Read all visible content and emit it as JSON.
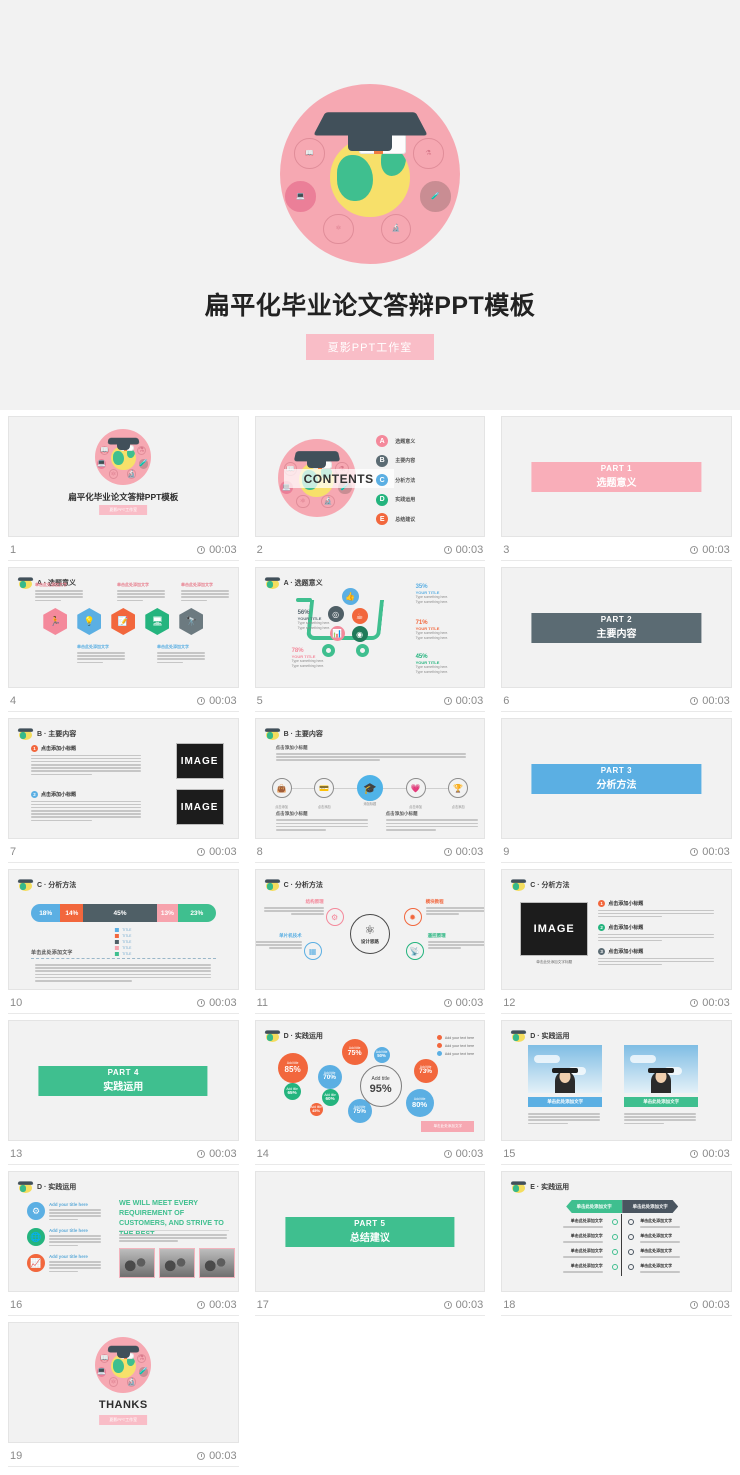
{
  "hero": {
    "title": "扁平化毕业论文答辩PPT模板",
    "badge": "夏影PPT工作室",
    "emblem_icons": [
      "book-icon",
      "microscope-stand-icon",
      "laptop-icon",
      "flask-icon",
      "atom-icon",
      "microscope-icon"
    ]
  },
  "colors": {
    "pink": "#f6a8b2",
    "pink_badge": "#f9bdc7",
    "slate": "#5b6b73",
    "blue": "#5bafe3",
    "green": "#3fbf8f",
    "orange": "#f2673d",
    "gray": "#6c7a80",
    "page_bg": "#ffffff",
    "thumb_bg": "#f2f2f2"
  },
  "slides": [
    {
      "index": "1",
      "duration": "00:03",
      "type": "cover",
      "title": "扁平化毕业论文答辩PPT模板",
      "badge": "夏影PPT工作室"
    },
    {
      "index": "2",
      "duration": "00:03",
      "type": "contents",
      "contents_label": "CONTENTS",
      "items": [
        {
          "letter": "A",
          "label": "选题意义",
          "color": "#f4899b"
        },
        {
          "letter": "B",
          "label": "主要内容",
          "color": "#5b6b73"
        },
        {
          "letter": "C",
          "label": "分析方法",
          "color": "#5bafe3"
        },
        {
          "letter": "D",
          "label": "实践运用",
          "color": "#24b47e"
        },
        {
          "letter": "E",
          "label": "总结建议",
          "color": "#f2673d"
        }
      ]
    },
    {
      "index": "3",
      "duration": "00:03",
      "type": "part",
      "part": "PART 1",
      "part_title": "选题意义",
      "banner_color": "#f9aeb9"
    },
    {
      "index": "4",
      "duration": "00:03",
      "type": "hex",
      "header": "A · 选题意义",
      "hexes": [
        {
          "color": "#f4899b",
          "icon": "person-icon"
        },
        {
          "color": "#5bafe3",
          "icon": "bulb-icon"
        },
        {
          "color": "#f2673d",
          "icon": "edit-icon"
        },
        {
          "color": "#24b47e",
          "icon": "monitor-icon"
        },
        {
          "color": "#6c7a80",
          "icon": "rocket-icon"
        }
      ],
      "notes": [
        {
          "title": "单击此处添加文字",
          "body": "点击添加文字内容点击添加文字内容点击添加文字内容点击添加文字内容"
        },
        {
          "title": "单击此处添加文字",
          "body": "点击添加文字内容点击添加文字内容点击添加文字内容点击添加文字内容"
        },
        {
          "title": "单击此处添加文字",
          "body": "点击添加文字内容点击添加文字内容点击添加文字内容点击添加文字内容"
        },
        {
          "title": "单击此处添加文字",
          "body": "点击添加文字内容点击添加文字内容点击添加文字内容点击添加文字内容"
        },
        {
          "title": "单击此处添加文字",
          "body": "点击添加文字内容点击添加文字内容点击添加文字内容点击添加文字内容"
        }
      ]
    },
    {
      "index": "5",
      "duration": "00:03",
      "type": "cart",
      "header": "A · 选题意义",
      "title_text": "YOUR TITLE",
      "body_text": "Type something here.",
      "notes": [
        {
          "pct": "35%",
          "color": "#5bafe3"
        },
        {
          "pct": "56%",
          "color": "#5b6b73"
        },
        {
          "pct": "71%",
          "color": "#f2673d"
        },
        {
          "pct": "78%",
          "color": "#f4899b"
        },
        {
          "pct": "45%",
          "color": "#24b47e"
        }
      ]
    },
    {
      "index": "6",
      "duration": "00:03",
      "type": "part",
      "part": "PART 2",
      "part_title": "主要内容",
      "banner_color": "#5b6b73"
    },
    {
      "index": "7",
      "duration": "00:03",
      "type": "image-text",
      "header": "B · 主要内容",
      "image_label": "IMAGE",
      "blocks": [
        {
          "num": "1",
          "color": "#f2673d",
          "title": "点击添加小标题",
          "body": "点击添加文字内容 点击添加文字内容 点击添加文字内容点击添加文字内容 点击添加文字内容 点击添加文字内容点击添加文字内容点击添加文字内容"
        },
        {
          "num": "2",
          "color": "#5bafe3",
          "title": "点击添加小标题",
          "body": "点击添加文字内容 点击添加文字内容 点击添加文字内容点击添加文字内容 点击添加文字内容 点击添加文字内容点击添加文字内容点击添加文字内容"
        }
      ]
    },
    {
      "index": "8",
      "duration": "00:03",
      "type": "timeline",
      "header": "B · 主要内容",
      "lead_title": "点击添加小标题",
      "lead_body": "点击添加文字内容 点击添加文字内容 点击添加文字内容 点击添加文字内容点击添加文字内容 点击添加文字内容",
      "nodes": [
        {
          "icon": "bag-icon",
          "caption": "点击添加"
        },
        {
          "icon": "card-icon",
          "caption": "点击添加"
        },
        {
          "icon": "graduation-cap-icon",
          "caption": "添加标题",
          "active": true
        },
        {
          "icon": "heart-icon",
          "caption": "点击添加"
        },
        {
          "icon": "cup-icon",
          "caption": "点击添加"
        }
      ],
      "foot_blocks": [
        {
          "title": "点击添加小标题",
          "body": "点击添加文字内容 点击添加文字内容 点击添加文字内容 点击添加文字内容"
        },
        {
          "title": "点击添加小标题",
          "body": "点击添加文字内容 点击添加文字内容 点击添加文字内容 点击添加文字内容"
        }
      ]
    },
    {
      "index": "9",
      "duration": "00:03",
      "type": "part",
      "part": "PART 3",
      "part_title": "分析方法",
      "banner_color": "#5bafe3"
    },
    {
      "index": "10",
      "duration": "00:03",
      "type": "stacked-bar",
      "header": "C · 分析方法",
      "caption": "单击此处添加文字",
      "body": "点击添加文字内容 点击添加文字内容 点击添加文字内容 点击添加文字内容点击添加文字内容 点击添加文字内容 点击添加文字内容 点击添加文字内容点击添加文字内容点击添加文字内容点击添加文字内容点击添加文字内容点击添加文字内容"
    },
    {
      "index": "11",
      "duration": "00:03",
      "type": "mindmap",
      "header": "C · 分析方法",
      "center": "设计思路",
      "branches": [
        {
          "label": "结构原理",
          "color": "#f4899b",
          "icon": "gear-icon"
        },
        {
          "label": "单片机技术",
          "color": "#5bafe3",
          "icon": "chip-icon"
        },
        {
          "label": "模块教程",
          "color": "#f2673d",
          "icon": "module-icon"
        },
        {
          "label": "遥控原理",
          "color": "#24b47e",
          "icon": "antenna-icon"
        }
      ],
      "body": "点击此处添加文字内容 点击此处添加文字内容 点击此处添加文字内容"
    },
    {
      "index": "12",
      "duration": "00:03",
      "type": "image-list",
      "header": "C · 分析方法",
      "image_label": "IMAGE",
      "image_caption": "单击此处添加文字标题",
      "items": [
        {
          "num": "1",
          "color": "#f2673d",
          "title": "点击添加小标题",
          "body": "点击添加文字内容 点击添加文字内容 点击添加文字内容 点击添加文字内容"
        },
        {
          "num": "2",
          "color": "#24b47e",
          "title": "点击添加小标题",
          "body": "点击添加文字内容 点击添加文字内容 点击添加文字内容 点击添加文字内容"
        },
        {
          "num": "3",
          "color": "#5b6b73",
          "title": "点击添加小标题",
          "body": "点击添加文字内容 点击添加文字内容 点击添加文字内容 点击添加文字内容"
        }
      ]
    },
    {
      "index": "13",
      "duration": "00:03",
      "type": "part",
      "part": "PART 4",
      "part_title": "实践运用",
      "banner_color": "#3fbf8f"
    },
    {
      "index": "14",
      "duration": "00:03",
      "type": "bubble",
      "header": "D · 实践运用",
      "center_title": "Add title",
      "center_value": "95%",
      "legend": [
        "Add your text here",
        "Add your text here",
        "Add your text here"
      ],
      "legend_colors": [
        "#f2673d",
        "#f2673d",
        "#5bafe3"
      ],
      "note": "单击此处添加文字"
    },
    {
      "index": "15",
      "duration": "00:03",
      "type": "two-photos",
      "header": "D · 实践运用",
      "cards": [
        {
          "caption": "单击此处添加文字",
          "color": "#5bafe3",
          "body": "点击添加文字内容 点击添加文字内容 点击添加文字内容 点击添加文字内容 点击添加文字内容 点击添加文字内容"
        },
        {
          "caption": "单击此处添加文字",
          "color": "#3fbf8f",
          "body": "点击添加文字内容 点击添加文字内容 点击添加文字内容 点击添加文字内容 点击添加文字内容 点击添加文字内容"
        }
      ]
    },
    {
      "index": "16",
      "duration": "00:03",
      "type": "quote",
      "header": "D · 实践运用",
      "headline": "WE WILL MEET EVERY REQUIREMENT OF CUSTOMERS, AND STRIVE TO THE BEST.",
      "quote": "The Board Meeting had come to an end, Bob denied to stand up and patted the table, spilling his coffee over his notes. \"How embarrassing, I am getting so clumsy in my old age.",
      "items": [
        {
          "title": "Add your title here",
          "color": "#5bafe3",
          "icon": "gear-icon",
          "body": "The Board Meeting had come to an end, Bob denied to stand up and patted the table, spilling his coffee over his notes."
        },
        {
          "title": "Add your title here",
          "color": "#24b47e",
          "icon": "globe-icon",
          "body": "The Board Meeting had come to an end, Bob denied to stand up and patted the table, spilling his coffee over his notes."
        },
        {
          "title": "Add your title here",
          "color": "#f2673d",
          "icon": "chart-icon",
          "body": "The Board Meeting had come to an end, Bob denied to stand up and patted the table, spilling his coffee over his notes."
        }
      ]
    },
    {
      "index": "17",
      "duration": "00:03",
      "type": "part",
      "part": "PART 5",
      "part_title": "总结建议",
      "banner_color": "#3fbf8f"
    },
    {
      "index": "18",
      "duration": "00:03",
      "type": "compare",
      "header": "E · 实践运用",
      "left_head": "单击此处添加文字",
      "right_head": "单击此处添加文字",
      "rows": [
        {
          "title": "单击此处添加文字",
          "body": "单击此处添加文字已更改你的设置点击"
        },
        {
          "title": "单击此处添加文字",
          "body": "单击此处添加文字已更改你的设置点击"
        },
        {
          "title": "单击此处添加文字",
          "body": "单击此处添加文字已更改你的设置点击"
        },
        {
          "title": "单击此处添加文字",
          "body": "单击此处添加文字已更改你的设置点击"
        }
      ]
    },
    {
      "index": "19",
      "duration": "00:03",
      "type": "thanks",
      "thanks": "THANKS",
      "badge": "夏影PPT工作室"
    }
  ],
  "chart_data": [
    {
      "type": "bar",
      "slide": "10",
      "title": "单击此处添加文字",
      "orientation": "horizontal-stacked",
      "categories": [
        "TITLE",
        "TITLE",
        "TITLE",
        "TITLE",
        "TITLE"
      ],
      "values": [
        18,
        14,
        45,
        13,
        23
      ],
      "labels": [
        "18%",
        "14%",
        "45%",
        "13%",
        "23%"
      ],
      "colors": [
        "#5bafe3",
        "#f2673d",
        "#4f5f66",
        "#f7a3ad",
        "#3fbf8f"
      ],
      "legend": [
        "TITLE",
        "TITLE",
        "TITLE",
        "TITLE",
        "TITLE"
      ],
      "legend_position": "below-center",
      "grid": false,
      "xlabel": "",
      "ylabel": ""
    },
    {
      "type": "scatter",
      "slide": "14",
      "title": "Add title 95%",
      "series": [
        {
          "name": "Add your text here",
          "color": "#f2673d",
          "points": [
            {
              "label": "Add title",
              "value": 85
            },
            {
              "label": "Add title",
              "value": 75
            },
            {
              "label": "Add title",
              "value": 73
            },
            {
              "label": "Add title",
              "value": 45
            }
          ]
        },
        {
          "name": "Add your text here",
          "color": "#24b47e",
          "points": [
            {
              "label": "Add title",
              "value": 65
            },
            {
              "label": "Add title",
              "value": 60
            }
          ]
        },
        {
          "name": "Add your text here",
          "color": "#5bafe3",
          "points": [
            {
              "label": "Add title",
              "value": 70
            },
            {
              "label": "Add title",
              "value": 50
            },
            {
              "label": "Add title",
              "value": 80
            },
            {
              "label": "Add title",
              "value": 75
            }
          ]
        }
      ],
      "center": {
        "label": "Add title",
        "value": 95
      },
      "legend_position": "top-right",
      "grid": false
    },
    {
      "type": "pie",
      "slide": "5",
      "title": "YOUR TITLE",
      "categories": [
        "35%",
        "56%",
        "71%",
        "78%",
        "45%"
      ],
      "values": [
        35,
        56,
        71,
        78,
        45
      ],
      "colors": [
        "#5bafe3",
        "#5b6b73",
        "#f2673d",
        "#f4899b",
        "#24b47e"
      ],
      "annotation": "Type something here.",
      "grid": false
    }
  ]
}
